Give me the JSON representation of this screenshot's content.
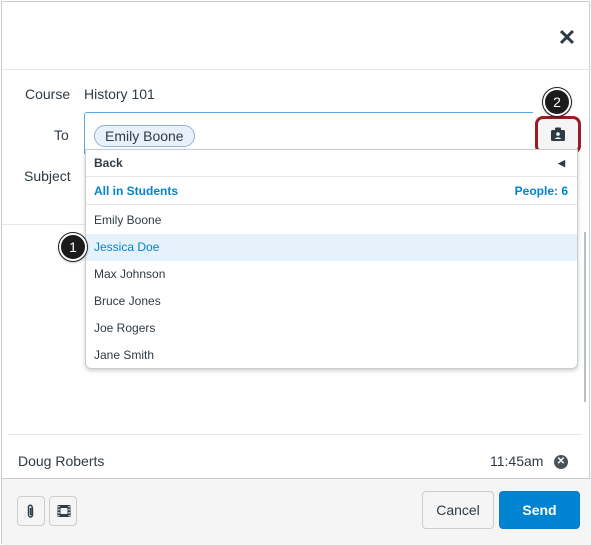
{
  "dialog": {
    "close_label": "✕"
  },
  "form": {
    "course_label": "Course",
    "course_value": "History 101",
    "to_label": "To",
    "to_recipient": "Emily Boone",
    "subject_label": "Subject",
    "address_book_icon": "address-book-icon"
  },
  "dropdown": {
    "back_label": "Back",
    "group_label": "All in Students",
    "people_count": "People: 6",
    "items": [
      {
        "label": "Emily Boone"
      },
      {
        "label": "Jessica Doe"
      },
      {
        "label": "Max Johnson"
      },
      {
        "label": "Bruce Jones"
      },
      {
        "label": "Joe Rogers"
      },
      {
        "label": "Jane Smith"
      }
    ],
    "selected_index": 1
  },
  "message": {
    "author": "Doug Roberts",
    "time": "11:45am"
  },
  "footer": {
    "attach_icon": "paperclip-icon",
    "media_icon": "media-icon",
    "cancel_label": "Cancel",
    "send_label": "Send"
  },
  "callouts": {
    "one": "1",
    "two": "2"
  },
  "colors": {
    "accent": "#0084d1",
    "highlight_border": "#9b1c22"
  }
}
